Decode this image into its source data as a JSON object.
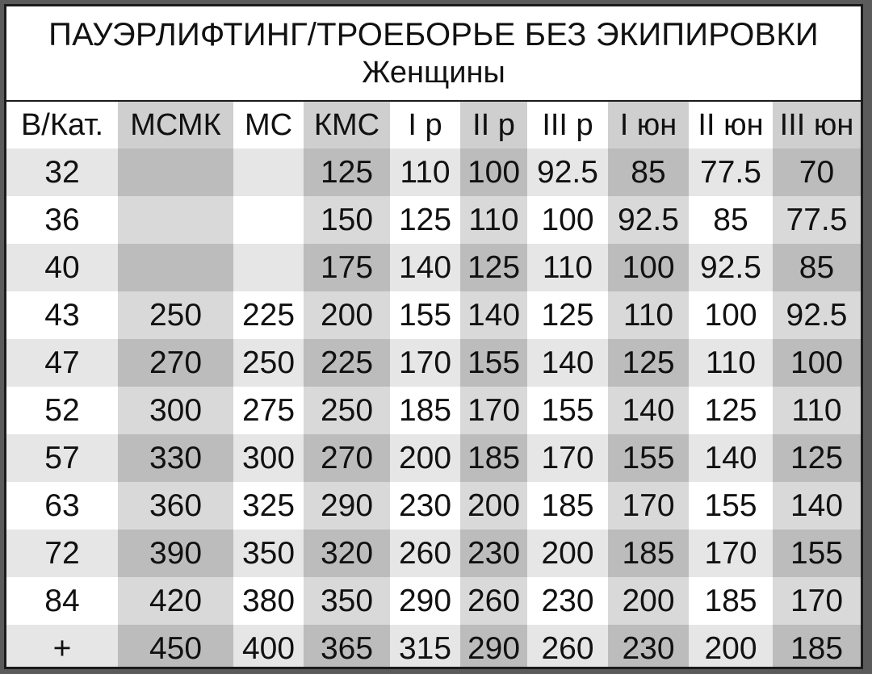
{
  "title": "ПАУЭРЛИФТИНГ/ТРОЕБОРЬЕ БЕЗ ЭКИПИРОВКИ",
  "subtitle": "Женщины",
  "headers": [
    "В/Кат.",
    "МСМК",
    "МС",
    "КМС",
    "I р",
    "II р",
    "III р",
    "I юн",
    "II юн",
    "III юн"
  ],
  "rows": [
    [
      "32",
      "",
      "",
      "125",
      "110",
      "100",
      "92.5",
      "85",
      "77.5",
      "70"
    ],
    [
      "36",
      "",
      "",
      "150",
      "125",
      "110",
      "100",
      "92.5",
      "85",
      "77.5"
    ],
    [
      "40",
      "",
      "",
      "175",
      "140",
      "125",
      "110",
      "100",
      "92.5",
      "85"
    ],
    [
      "43",
      "250",
      "225",
      "200",
      "155",
      "140",
      "125",
      "110",
      "100",
      "92.5"
    ],
    [
      "47",
      "270",
      "250",
      "225",
      "170",
      "155",
      "140",
      "125",
      "110",
      "100"
    ],
    [
      "52",
      "300",
      "275",
      "250",
      "185",
      "170",
      "155",
      "140",
      "125",
      "110"
    ],
    [
      "57",
      "330",
      "300",
      "270",
      "200",
      "185",
      "170",
      "155",
      "140",
      "125"
    ],
    [
      "63",
      "360",
      "325",
      "290",
      "230",
      "200",
      "185",
      "170",
      "155",
      "140"
    ],
    [
      "72",
      "390",
      "350",
      "320",
      "260",
      "230",
      "200",
      "185",
      "170",
      "155"
    ],
    [
      "84",
      "420",
      "380",
      "350",
      "290",
      "260",
      "230",
      "200",
      "185",
      "170"
    ],
    [
      "+",
      "450",
      "400",
      "365",
      "315",
      "290",
      "260",
      "230",
      "200",
      "185"
    ]
  ],
  "colors": {
    "frame_bg": "#5b5b5b",
    "border": "#1b1b1b",
    "white": "#ffffff",
    "light": "#e6e6e6",
    "mid": "#cfcfcf",
    "mid_alt": "#d9d9d9",
    "dark": "#bcbcbc",
    "dark_alt": "#c7c7c7"
  }
}
